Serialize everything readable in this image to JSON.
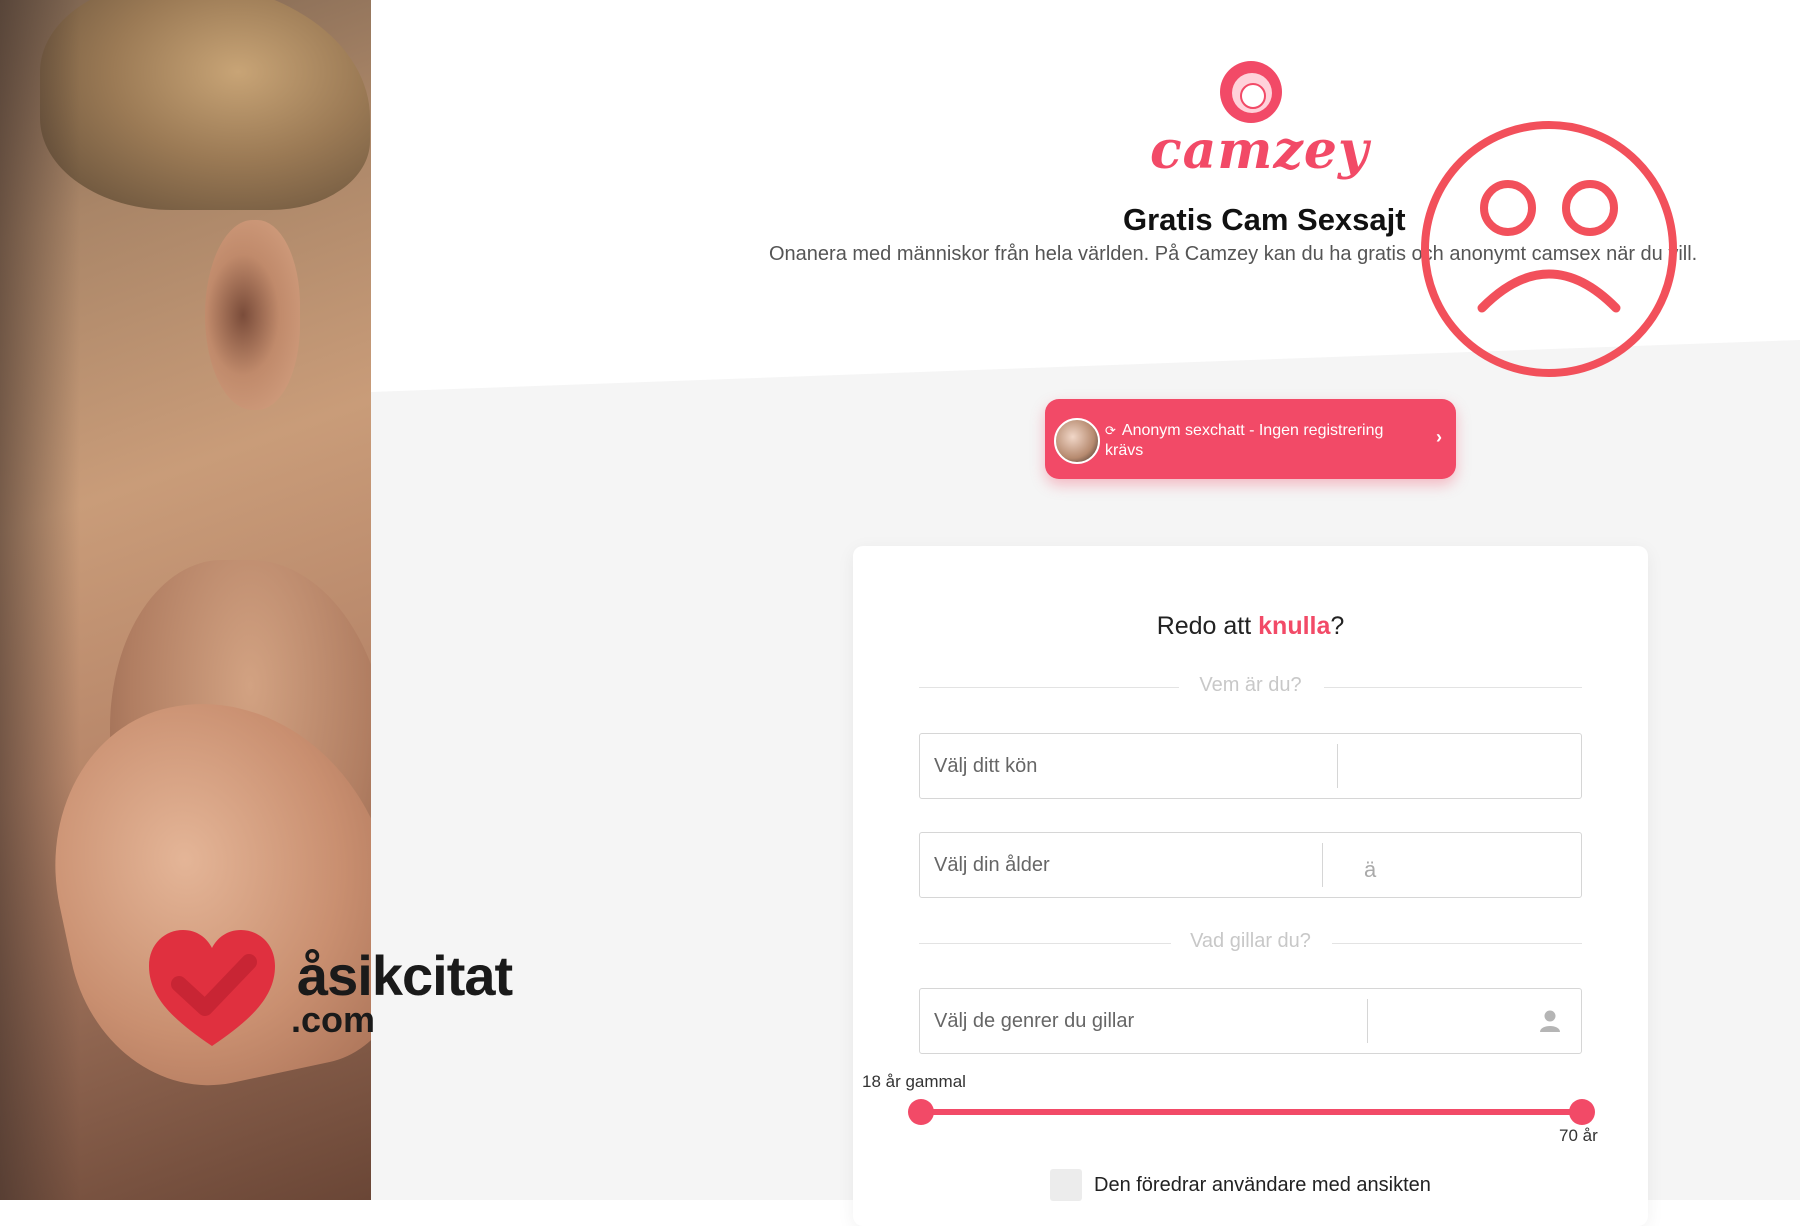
{
  "header": {
    "logo_text": "camzey",
    "title": "Gratis Cam Sexsajt",
    "subtitle": "Onanera med människor från hela världen. På Camzey kan du ha gratis och anonymt camsex när du vill."
  },
  "anon_button": {
    "icon": "refresh-icon",
    "label": "Anonym sexchatt - Ingen registrering krävs",
    "chevron": "›"
  },
  "form": {
    "title_prefix": "Redo att ",
    "title_highlight": "knulla",
    "title_suffix": "?",
    "section_who": "Vem är du?",
    "gender_placeholder": "Välj ditt kön",
    "age_placeholder": "Välj din ålder",
    "age_glyph": "ä",
    "section_likes": "Vad gillar du?",
    "genre_placeholder": "Välj de genrer du gillar",
    "genre_icon": "user-icon",
    "range": {
      "min_label": "18 år gammal",
      "max_label": "70 år",
      "min": 18,
      "max": 70
    },
    "checkbox_label": "Den föredrar användare med ansikten",
    "checkbox_checked": false
  },
  "watermark": {
    "name": "åsikcitat",
    "domain": ".com"
  },
  "colors": {
    "accent": "#f24a67",
    "sad_face": "#f2505b",
    "watermark_heart": "#e0303f"
  }
}
